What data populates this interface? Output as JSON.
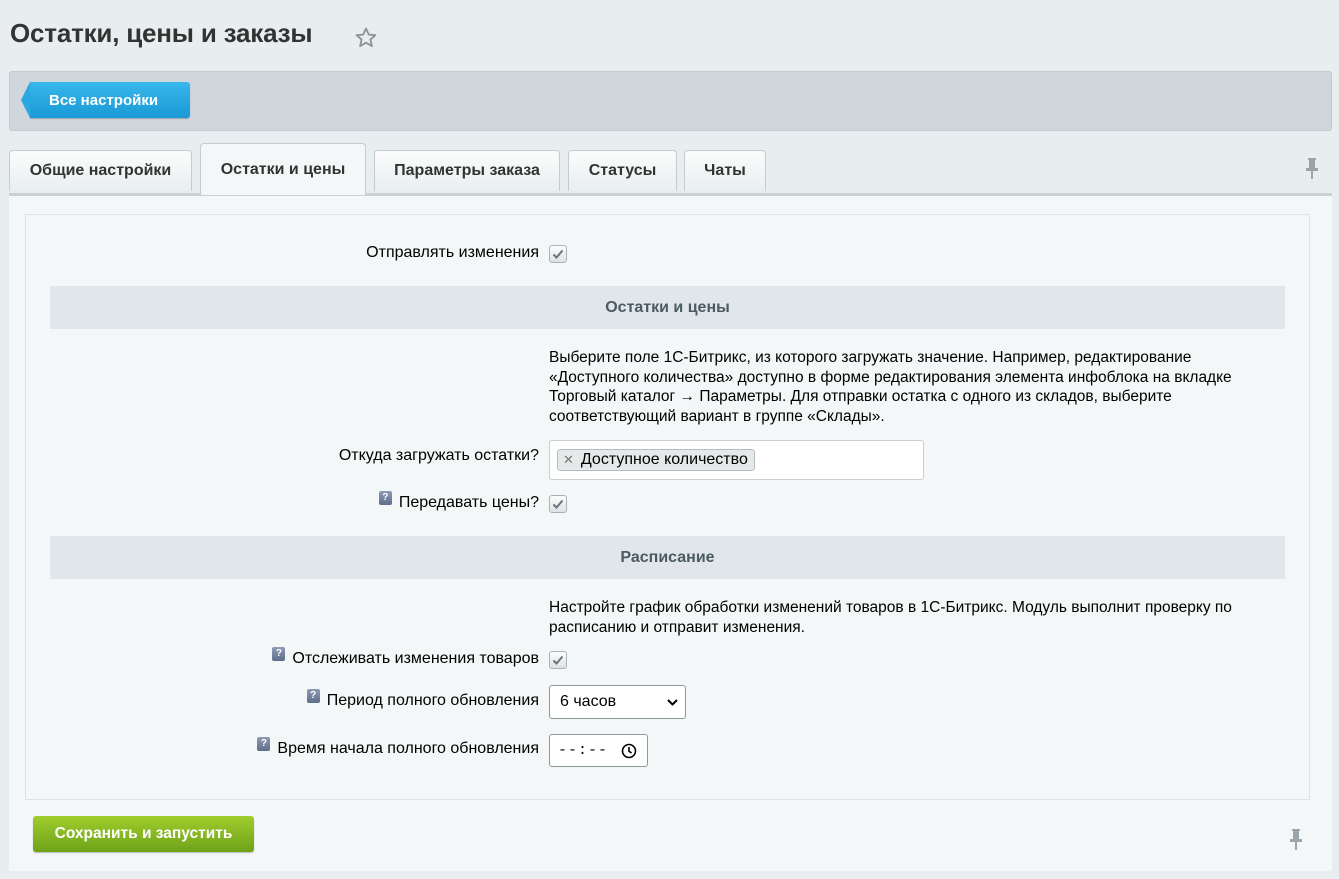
{
  "header": {
    "title": "Остатки, цены и заказы"
  },
  "toolbar": {
    "back_label": "Все настройки"
  },
  "tabs": [
    {
      "label": "Общие настройки"
    },
    {
      "label": "Остатки и цены",
      "active": true
    },
    {
      "label": "Параметры заказа"
    },
    {
      "label": "Статусы"
    },
    {
      "label": "Чаты"
    }
  ],
  "form": {
    "send_changes": {
      "label": "Отправлять изменения",
      "checked": true
    },
    "section_stock": {
      "title": "Остатки и цены",
      "description": "Выберите поле 1С-Битрикс, из которого загружать значение. Например, редактирование «Доступного количества» доступно в форме редактирования элемента инфоблока на вкладке Торговый каталог → Параметры. Для отправки остатка с одного из складов, выберите соответствующий вариант в группе «Склады»."
    },
    "stock_source": {
      "label": "Откуда загружать остатки?",
      "selected": [
        "Доступное количество"
      ]
    },
    "send_prices": {
      "label": "Передавать цены?",
      "checked": true,
      "help": "?"
    },
    "section_schedule": {
      "title": "Расписание",
      "description": "Настройте график обработки изменений товаров в 1С-Битрикс. Модуль выполнит проверку по расписанию и отправит изменения."
    },
    "track_changes": {
      "label": "Отслеживать изменения товаров",
      "checked": true,
      "help": "?"
    },
    "full_update_period": {
      "label": "Период полного обновления",
      "value": "6 часов",
      "help": "?"
    },
    "full_update_start": {
      "label": "Время начала полного обновления",
      "value": "--:--",
      "help": "?"
    }
  },
  "footer": {
    "save_label": "Сохранить и запустить"
  },
  "colors": {
    "accent_blue": "#1a9ad6",
    "accent_green": "#7ab31f"
  }
}
